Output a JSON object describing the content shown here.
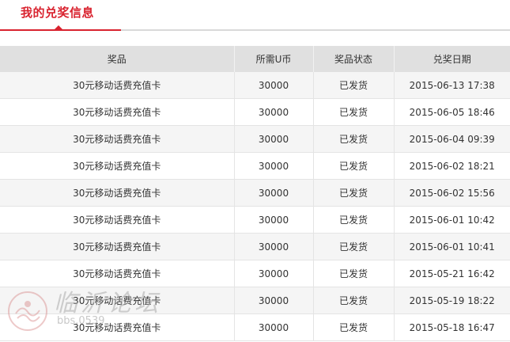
{
  "header": {
    "title": "我的兑奖信息",
    "accent_color": "#d9232f"
  },
  "table": {
    "columns": [
      "奖品",
      "所需U币",
      "奖品状态",
      "兑奖日期"
    ],
    "rows": [
      {
        "prize": "30元移动话费充值卡",
        "cost": "30000",
        "status": "已发货",
        "date": "2015-06-13 17:38"
      },
      {
        "prize": "30元移动话费充值卡",
        "cost": "30000",
        "status": "已发货",
        "date": "2015-06-05 18:46"
      },
      {
        "prize": "30元移动话费充值卡",
        "cost": "30000",
        "status": "已发货",
        "date": "2015-06-04 09:39"
      },
      {
        "prize": "30元移动话费充值卡",
        "cost": "30000",
        "status": "已发货",
        "date": "2015-06-02 18:21"
      },
      {
        "prize": "30元移动话费充值卡",
        "cost": "30000",
        "status": "已发货",
        "date": "2015-06-02 15:56"
      },
      {
        "prize": "30元移动话费充值卡",
        "cost": "30000",
        "status": "已发货",
        "date": "2015-06-01 10:42"
      },
      {
        "prize": "30元移动话费充值卡",
        "cost": "30000",
        "status": "已发货",
        "date": "2015-06-01 10:41"
      },
      {
        "prize": "30元移动话费充值卡",
        "cost": "30000",
        "status": "已发货",
        "date": "2015-05-21 16:42"
      },
      {
        "prize": "30元移动话费充值卡",
        "cost": "30000",
        "status": "已发货",
        "date": "2015-05-19 18:22"
      },
      {
        "prize": "30元移动话费充值卡",
        "cost": "30000",
        "status": "已发货",
        "date": "2015-05-18 16:47"
      }
    ]
  },
  "watermark": {
    "text": "临沂论坛",
    "url": "bbs.0539"
  }
}
